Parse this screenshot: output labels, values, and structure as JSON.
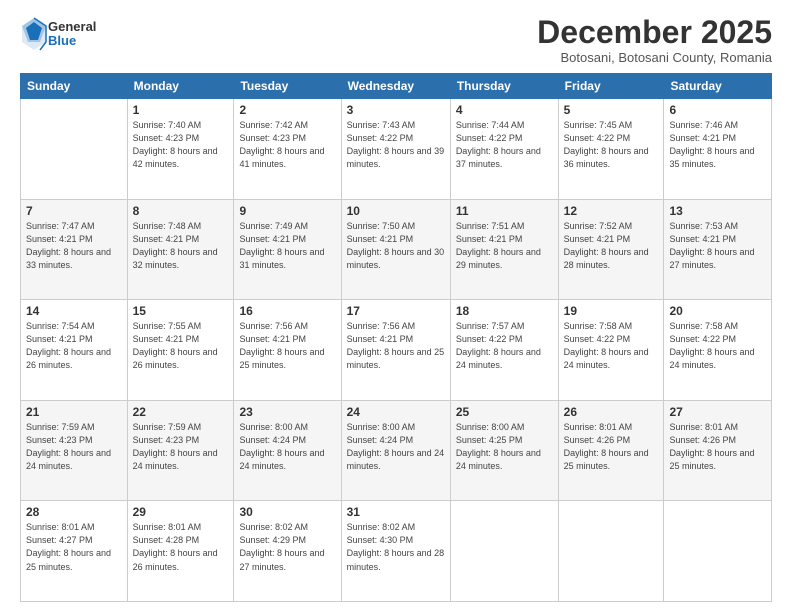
{
  "logo": {
    "general": "General",
    "blue": "Blue"
  },
  "header": {
    "month": "December 2025",
    "location": "Botosani, Botosani County, Romania"
  },
  "weekdays": [
    "Sunday",
    "Monday",
    "Tuesday",
    "Wednesday",
    "Thursday",
    "Friday",
    "Saturday"
  ],
  "weeks": [
    [
      {
        "day": "",
        "sunrise": "",
        "sunset": "",
        "daylight": ""
      },
      {
        "day": "1",
        "sunrise": "Sunrise: 7:40 AM",
        "sunset": "Sunset: 4:23 PM",
        "daylight": "Daylight: 8 hours and 42 minutes."
      },
      {
        "day": "2",
        "sunrise": "Sunrise: 7:42 AM",
        "sunset": "Sunset: 4:23 PM",
        "daylight": "Daylight: 8 hours and 41 minutes."
      },
      {
        "day": "3",
        "sunrise": "Sunrise: 7:43 AM",
        "sunset": "Sunset: 4:22 PM",
        "daylight": "Daylight: 8 hours and 39 minutes."
      },
      {
        "day": "4",
        "sunrise": "Sunrise: 7:44 AM",
        "sunset": "Sunset: 4:22 PM",
        "daylight": "Daylight: 8 hours and 37 minutes."
      },
      {
        "day": "5",
        "sunrise": "Sunrise: 7:45 AM",
        "sunset": "Sunset: 4:22 PM",
        "daylight": "Daylight: 8 hours and 36 minutes."
      },
      {
        "day": "6",
        "sunrise": "Sunrise: 7:46 AM",
        "sunset": "Sunset: 4:21 PM",
        "daylight": "Daylight: 8 hours and 35 minutes."
      }
    ],
    [
      {
        "day": "7",
        "sunrise": "Sunrise: 7:47 AM",
        "sunset": "Sunset: 4:21 PM",
        "daylight": "Daylight: 8 hours and 33 minutes."
      },
      {
        "day": "8",
        "sunrise": "Sunrise: 7:48 AM",
        "sunset": "Sunset: 4:21 PM",
        "daylight": "Daylight: 8 hours and 32 minutes."
      },
      {
        "day": "9",
        "sunrise": "Sunrise: 7:49 AM",
        "sunset": "Sunset: 4:21 PM",
        "daylight": "Daylight: 8 hours and 31 minutes."
      },
      {
        "day": "10",
        "sunrise": "Sunrise: 7:50 AM",
        "sunset": "Sunset: 4:21 PM",
        "daylight": "Daylight: 8 hours and 30 minutes."
      },
      {
        "day": "11",
        "sunrise": "Sunrise: 7:51 AM",
        "sunset": "Sunset: 4:21 PM",
        "daylight": "Daylight: 8 hours and 29 minutes."
      },
      {
        "day": "12",
        "sunrise": "Sunrise: 7:52 AM",
        "sunset": "Sunset: 4:21 PM",
        "daylight": "Daylight: 8 hours and 28 minutes."
      },
      {
        "day": "13",
        "sunrise": "Sunrise: 7:53 AM",
        "sunset": "Sunset: 4:21 PM",
        "daylight": "Daylight: 8 hours and 27 minutes."
      }
    ],
    [
      {
        "day": "14",
        "sunrise": "Sunrise: 7:54 AM",
        "sunset": "Sunset: 4:21 PM",
        "daylight": "Daylight: 8 hours and 26 minutes."
      },
      {
        "day": "15",
        "sunrise": "Sunrise: 7:55 AM",
        "sunset": "Sunset: 4:21 PM",
        "daylight": "Daylight: 8 hours and 26 minutes."
      },
      {
        "day": "16",
        "sunrise": "Sunrise: 7:56 AM",
        "sunset": "Sunset: 4:21 PM",
        "daylight": "Daylight: 8 hours and 25 minutes."
      },
      {
        "day": "17",
        "sunrise": "Sunrise: 7:56 AM",
        "sunset": "Sunset: 4:21 PM",
        "daylight": "Daylight: 8 hours and 25 minutes."
      },
      {
        "day": "18",
        "sunrise": "Sunrise: 7:57 AM",
        "sunset": "Sunset: 4:22 PM",
        "daylight": "Daylight: 8 hours and 24 minutes."
      },
      {
        "day": "19",
        "sunrise": "Sunrise: 7:58 AM",
        "sunset": "Sunset: 4:22 PM",
        "daylight": "Daylight: 8 hours and 24 minutes."
      },
      {
        "day": "20",
        "sunrise": "Sunrise: 7:58 AM",
        "sunset": "Sunset: 4:22 PM",
        "daylight": "Daylight: 8 hours and 24 minutes."
      }
    ],
    [
      {
        "day": "21",
        "sunrise": "Sunrise: 7:59 AM",
        "sunset": "Sunset: 4:23 PM",
        "daylight": "Daylight: 8 hours and 24 minutes."
      },
      {
        "day": "22",
        "sunrise": "Sunrise: 7:59 AM",
        "sunset": "Sunset: 4:23 PM",
        "daylight": "Daylight: 8 hours and 24 minutes."
      },
      {
        "day": "23",
        "sunrise": "Sunrise: 8:00 AM",
        "sunset": "Sunset: 4:24 PM",
        "daylight": "Daylight: 8 hours and 24 minutes."
      },
      {
        "day": "24",
        "sunrise": "Sunrise: 8:00 AM",
        "sunset": "Sunset: 4:24 PM",
        "daylight": "Daylight: 8 hours and 24 minutes."
      },
      {
        "day": "25",
        "sunrise": "Sunrise: 8:00 AM",
        "sunset": "Sunset: 4:25 PM",
        "daylight": "Daylight: 8 hours and 24 minutes."
      },
      {
        "day": "26",
        "sunrise": "Sunrise: 8:01 AM",
        "sunset": "Sunset: 4:26 PM",
        "daylight": "Daylight: 8 hours and 25 minutes."
      },
      {
        "day": "27",
        "sunrise": "Sunrise: 8:01 AM",
        "sunset": "Sunset: 4:26 PM",
        "daylight": "Daylight: 8 hours and 25 minutes."
      }
    ],
    [
      {
        "day": "28",
        "sunrise": "Sunrise: 8:01 AM",
        "sunset": "Sunset: 4:27 PM",
        "daylight": "Daylight: 8 hours and 25 minutes."
      },
      {
        "day": "29",
        "sunrise": "Sunrise: 8:01 AM",
        "sunset": "Sunset: 4:28 PM",
        "daylight": "Daylight: 8 hours and 26 minutes."
      },
      {
        "day": "30",
        "sunrise": "Sunrise: 8:02 AM",
        "sunset": "Sunset: 4:29 PM",
        "daylight": "Daylight: 8 hours and 27 minutes."
      },
      {
        "day": "31",
        "sunrise": "Sunrise: 8:02 AM",
        "sunset": "Sunset: 4:30 PM",
        "daylight": "Daylight: 8 hours and 28 minutes."
      },
      {
        "day": "",
        "sunrise": "",
        "sunset": "",
        "daylight": ""
      },
      {
        "day": "",
        "sunrise": "",
        "sunset": "",
        "daylight": ""
      },
      {
        "day": "",
        "sunrise": "",
        "sunset": "",
        "daylight": ""
      }
    ]
  ]
}
